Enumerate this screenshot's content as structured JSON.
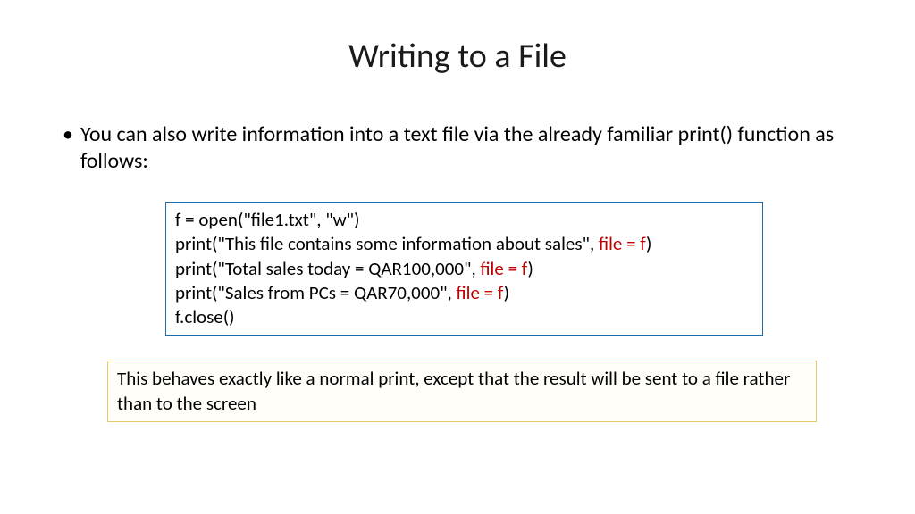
{
  "slide": {
    "title": "Writing to a File",
    "bullet": "You can also write information into a text file via the already familiar print() function as follows:",
    "code": {
      "line1": "f = open(\"file1.txt\", \"w\")",
      "line2_a": "print(\"This file contains some information about sales\", ",
      "line2_red": "file = f",
      "line2_b": ")",
      "line3_a": "print(\"Total sales today = QAR100,000\", ",
      "line3_red": "file = f",
      "line3_b": ")",
      "line4_a": "print(\"Sales from PCs = QAR70,000\", ",
      "line4_red": "file = f",
      "line4_b": ")",
      "line5": "f.close()"
    },
    "note": "This behaves exactly like a normal print, except that the result will be sent to a file rather than to the screen"
  }
}
